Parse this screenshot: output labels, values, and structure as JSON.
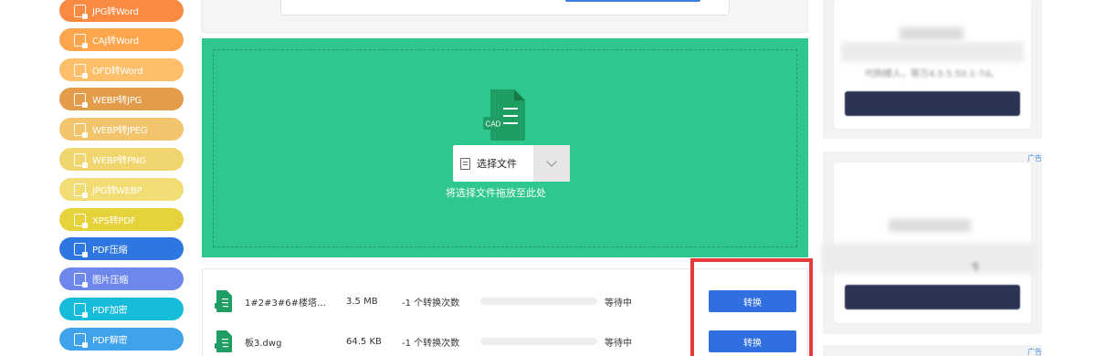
{
  "sidebar": {
    "items": [
      {
        "label": "JPG转Word",
        "color": "#f98a41"
      },
      {
        "label": "CAJ转Word",
        "color": "#fba64d"
      },
      {
        "label": "OFD转Word",
        "color": "#fdbf6a"
      },
      {
        "label": "WEBP转JPG",
        "color": "#e39c4a"
      },
      {
        "label": "WEBP转JPEG",
        "color": "#f2c46c"
      },
      {
        "label": "WEBP转PNG",
        "color": "#f1d56e"
      },
      {
        "label": "JPG转WEBP",
        "color": "#f1dd74"
      },
      {
        "label": "XPS转PDF",
        "color": "#e6d23a"
      },
      {
        "label": "PDF压缩",
        "color": "#2e77e3"
      },
      {
        "label": "图片压缩",
        "color": "#6d87ec"
      },
      {
        "label": "PDF加密",
        "color": "#17bcdb"
      },
      {
        "label": "PDF解密",
        "color": "#3fa3eb"
      }
    ]
  },
  "upload": {
    "icon_label": "CAD",
    "select_label": "选择文件",
    "drop_hint": "将选择文件拖放至此处",
    "bg_color": "#2ec78e"
  },
  "files": [
    {
      "name": "1#2#3#6#楼塔和...",
      "size": "3.5 MB",
      "count": "-1 个转换次数",
      "progress": 0,
      "status": "等待中",
      "button": "转换"
    },
    {
      "name": "板3.dwg",
      "size": "64.5 KB",
      "count": "-1 个转换次数",
      "progress": 0,
      "status": "等待中",
      "button": "转换"
    }
  ],
  "ads": {
    "tag": "广告",
    "blurred_text_1": "代购楼人，等万4.5.5.50.1-7d。",
    "blurred_text_2": "专"
  },
  "colors": {
    "convert_button": "#2f6fe0",
    "highlight": "#e73a3a",
    "ad_button": "#2c3455"
  }
}
